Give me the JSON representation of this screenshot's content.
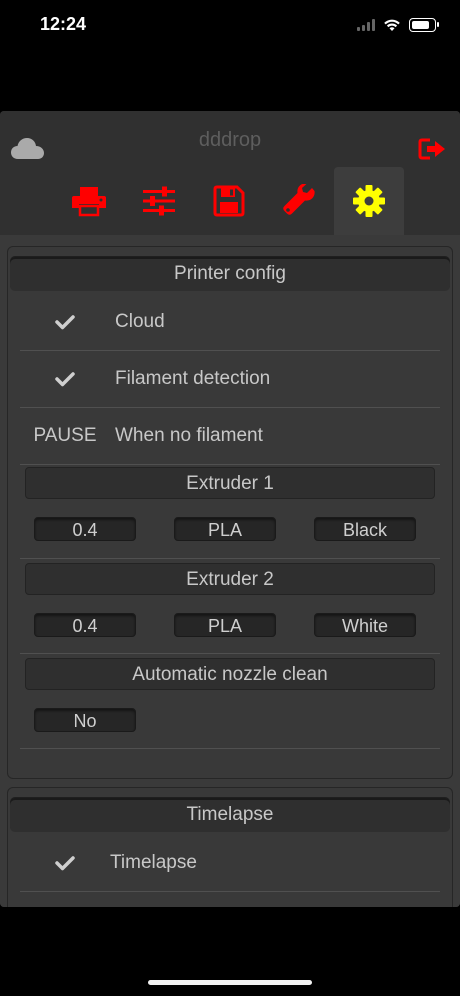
{
  "status_bar": {
    "time": "12:24",
    "battery_level": 0.9
  },
  "header": {
    "title": "dddrop",
    "cloud_icon": "cloud-icon",
    "logout_icon": "logout-icon",
    "accent_color": "#ff0000",
    "active_color": "#ffff00",
    "tabs": [
      {
        "icon": "printer-icon",
        "active": false
      },
      {
        "icon": "sliders-icon",
        "active": false
      },
      {
        "icon": "save-icon",
        "active": false
      },
      {
        "icon": "wrench-icon",
        "active": false
      },
      {
        "icon": "gear-icon",
        "active": true
      }
    ]
  },
  "printer_config": {
    "title": "Printer config",
    "cloud": {
      "icon": "check-icon",
      "label": "Cloud"
    },
    "filament_detection": {
      "icon": "check-icon",
      "label": "Filament detection"
    },
    "no_filament": {
      "action": "PAUSE",
      "label": "When no filament"
    },
    "extruder1": {
      "title": "Extruder 1",
      "nozzle": "0.4",
      "material": "PLA",
      "color": "Black"
    },
    "extruder2": {
      "title": "Extruder 2",
      "nozzle": "0.4",
      "material": "PLA",
      "color": "White"
    },
    "nozzle_clean": {
      "title": "Automatic nozzle clean",
      "value": "No"
    }
  },
  "timelapse": {
    "title": "Timelapse",
    "row": {
      "icon": "check-icon",
      "label": "Timelapse"
    }
  }
}
